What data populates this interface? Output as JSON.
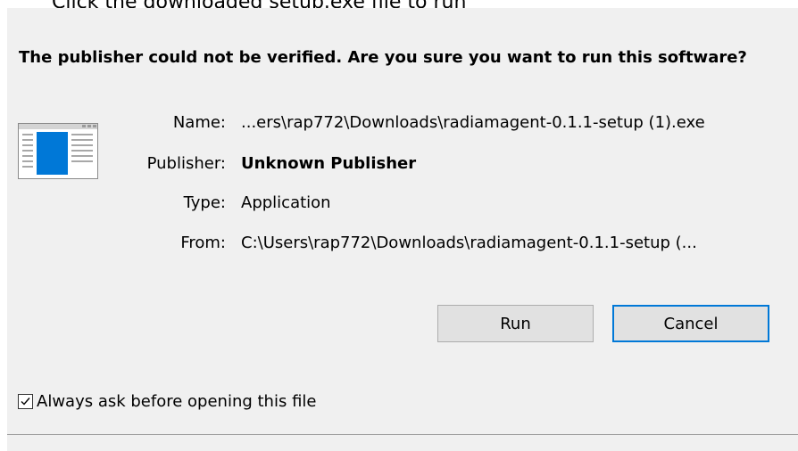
{
  "background_caption": "Click the downloaded setup.exe file to run",
  "dialog": {
    "headline": "The publisher could not be verified.  Are you sure you want to run this software?",
    "icon": "application-window-icon",
    "fields": [
      {
        "label": "Name:",
        "value": "...ers\\rap772\\Downloads\\radiamagent-0.1.1-setup (1).exe",
        "bold": false
      },
      {
        "label": "Publisher:",
        "value": "Unknown Publisher",
        "bold": true
      },
      {
        "label": "Type:",
        "value": "Application",
        "bold": false
      },
      {
        "label": "From:",
        "value": "C:\\Users\\rap772\\Downloads\\radiamagent-0.1.1-setup (...",
        "bold": false
      }
    ],
    "buttons": {
      "run_label": "Run",
      "cancel_label": "Cancel"
    },
    "checkbox": {
      "label": "Always ask before opening this file",
      "checked": true
    }
  },
  "colors": {
    "dialog_background": "#f0f0f0",
    "button_face": "#e1e1e1",
    "focus_border": "#0078d7",
    "icon_blue": "#0078d7"
  }
}
